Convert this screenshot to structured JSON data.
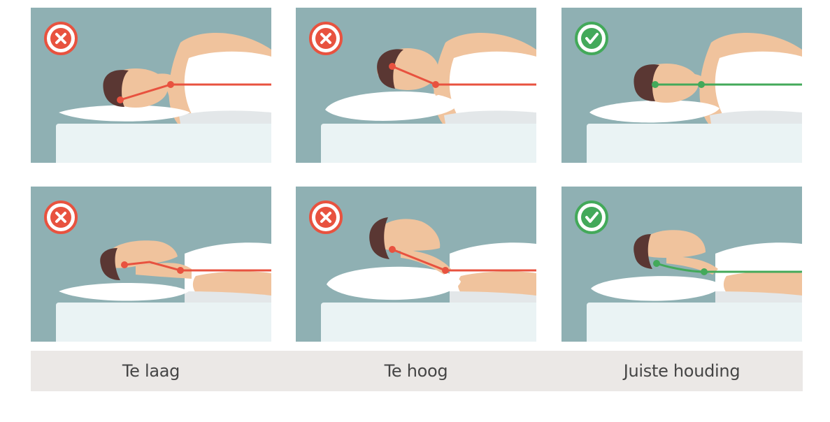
{
  "labels": {
    "too_low": "Te laag",
    "too_high": "Te hoog",
    "correct": "Juiste houding"
  },
  "icons": {
    "wrong": "cross-icon",
    "right": "check-icon"
  },
  "colors": {
    "background": "#8fb0b3",
    "wrong": "#e8523f",
    "right": "#43a95a",
    "mattress": "#eaf3f4",
    "pillow": "#ffffff",
    "skin": "#f0c39d",
    "hair": "#5a3733",
    "shirt": "#ffffff",
    "label_bar": "#ebe8e6"
  }
}
